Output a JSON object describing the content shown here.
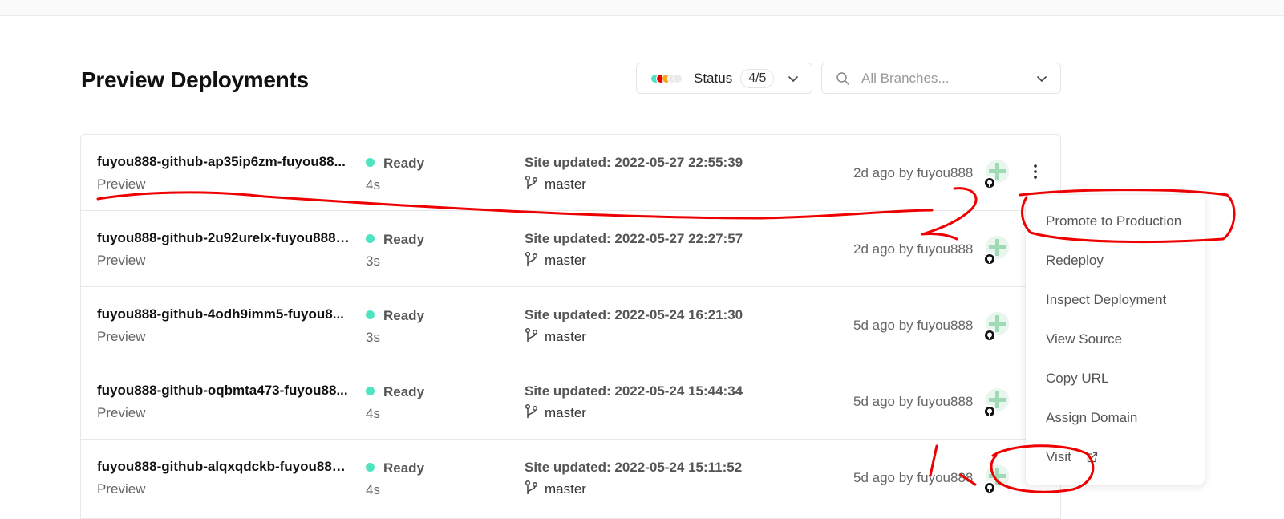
{
  "page_title": "Preview Deployments",
  "status_filter": {
    "label": "Status",
    "count": "4/5",
    "dot_colors": [
      "#50e3c2",
      "#ee0000",
      "#f5a623",
      "#eaeaea",
      "#eaeaea"
    ]
  },
  "branch_filter": {
    "placeholder": "All Branches..."
  },
  "deployments": [
    {
      "name": "fuyou888-github-ap35ip6zm-fuyou88...",
      "environment": "Preview",
      "status": "Ready",
      "duration": "4s",
      "updated": "Site updated: 2022-05-27 22:55:39",
      "branch": "master",
      "author_time": "2d ago by fuyou888"
    },
    {
      "name": "fuyou888-github-2u92urelx-fuyou888....",
      "environment": "Preview",
      "status": "Ready",
      "duration": "3s",
      "updated": "Site updated: 2022-05-27 22:27:57",
      "branch": "master",
      "author_time": "2d ago by fuyou888"
    },
    {
      "name": "fuyou888-github-4odh9imm5-fuyou8...",
      "environment": "Preview",
      "status": "Ready",
      "duration": "3s",
      "updated": "Site updated: 2022-05-24 16:21:30",
      "branch": "master",
      "author_time": "5d ago by fuyou888"
    },
    {
      "name": "fuyou888-github-oqbmta473-fuyou88...",
      "environment": "Preview",
      "status": "Ready",
      "duration": "4s",
      "updated": "Site updated: 2022-05-24 15:44:34",
      "branch": "master",
      "author_time": "5d ago by fuyou888"
    },
    {
      "name": "fuyou888-github-alqxqdckb-fuyou888...",
      "environment": "Preview",
      "status": "Ready",
      "duration": "4s",
      "updated": "Site updated: 2022-05-24 15:11:52",
      "branch": "master",
      "author_time": "5d ago by fuyou888"
    }
  ],
  "context_menu": {
    "items": [
      "Promote to Production",
      "Redeploy",
      "Inspect Deployment",
      "View Source",
      "Copy URL",
      "Assign Domain",
      "Visit"
    ]
  },
  "colors": {
    "ready": "#50e3c2",
    "annotation": "#ee0000"
  }
}
